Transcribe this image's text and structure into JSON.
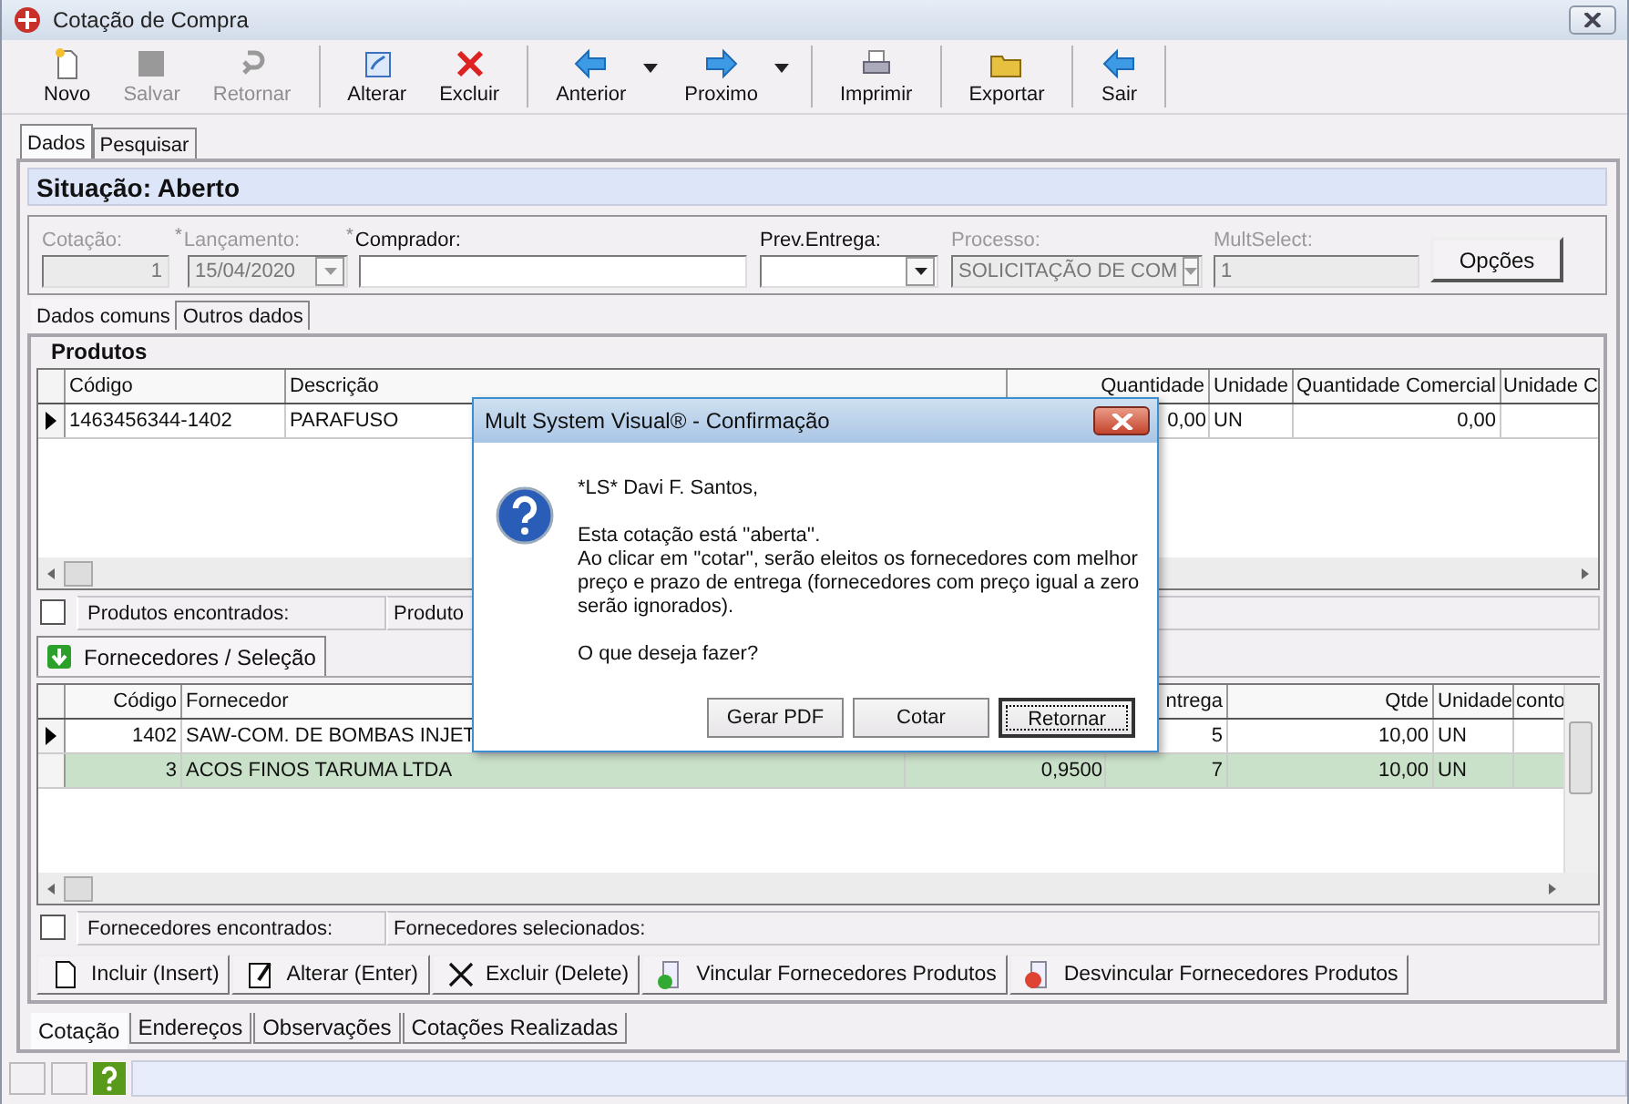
{
  "window": {
    "title": "Cotação de Compra"
  },
  "toolbar": [
    {
      "label": "Novo",
      "kind": "new",
      "disabled": false,
      "menu": false,
      "separator": false
    },
    {
      "label": "Salvar",
      "kind": "save",
      "disabled": true,
      "menu": false,
      "separator": false
    },
    {
      "label": "Retornar",
      "kind": "undo",
      "disabled": true,
      "menu": false,
      "separator": false
    },
    {
      "label": "Alterar",
      "kind": "edit",
      "disabled": false,
      "menu": false,
      "separator": true
    },
    {
      "label": "Excluir",
      "kind": "delete",
      "disabled": false,
      "menu": false,
      "separator": false
    },
    {
      "label": "Anterior",
      "kind": "prev",
      "disabled": false,
      "menu": true,
      "separator": true
    },
    {
      "label": "Proximo",
      "kind": "next",
      "disabled": false,
      "menu": true,
      "separator": false
    },
    {
      "label": "Imprimir",
      "kind": "print",
      "disabled": false,
      "menu": false,
      "separator": true
    },
    {
      "label": "Exportar",
      "kind": "export",
      "disabled": false,
      "menu": false,
      "separator": true
    },
    {
      "label": "Sair",
      "kind": "exit",
      "disabled": false,
      "menu": false,
      "separator": true
    }
  ],
  "tabs": [
    {
      "label": "Dados",
      "selected": true
    },
    {
      "label": "Pesquisar",
      "selected": false
    }
  ],
  "status": "Situação: Aberto",
  "fields": [
    {
      "label": "Cotação:",
      "kind": "number",
      "value": "1",
      "disabled": true
    },
    {
      "label": "Lançamento:",
      "kind": "date",
      "value": "15/04/2020",
      "disabled": true,
      "marker": "*"
    },
    {
      "label": "Comprador:",
      "kind": "text",
      "disabled": false,
      "marker": "*"
    },
    {
      "label": "Prev.Entrega:",
      "kind": "combo",
      "disabled": false
    },
    {
      "label": "Processo:",
      "kind": "combo",
      "value": "SOLICITAÇÃO DE COM",
      "disabled": true
    },
    {
      "label": "MultSelect:",
      "kind": "text",
      "value": "1",
      "disabled": true
    },
    {
      "label": "Opções",
      "kind": "button",
      "disabled": false
    }
  ],
  "inner_tabs": [
    {
      "label": "Dados comuns",
      "selected": true
    },
    {
      "label": "Outros dados",
      "selected": false
    }
  ],
  "products": {
    "title": "Produtos",
    "columns": [
      "Código",
      "Descrição",
      "Quantidade",
      "Unidade",
      "Quantidade Comercial",
      "Unidade C"
    ],
    "rows": [
      {
        "current": true,
        "selected": false,
        "cells": [
          "1463456344-1402",
          "PARAFUSO",
          "0,00",
          "UN",
          "0,00"
        ]
      }
    ],
    "footer": {
      "checked": false,
      "counts": [
        "Produtos encontrados:",
        "Produto"
      ]
    }
  },
  "suppliers": {
    "tab": "Fornecedores / Seleção",
    "columns": [
      "Código",
      "Fornecedor",
      null,
      "ntrega",
      "Qtde",
      "Unidade",
      "conto"
    ],
    "rows": [
      {
        "current": true,
        "selected": false,
        "cells": [
          "1402",
          "SAW-COM. DE BOMBAS INJET",
          null,
          "5",
          "10,00",
          "UN"
        ]
      },
      {
        "current": false,
        "selected": true,
        "cells": [
          "3",
          "ACOS FINOS TARUMA LTDA",
          "0,9500",
          "7",
          "10,00",
          "UN"
        ]
      }
    ],
    "footer": {
      "checked": false,
      "counts": [
        "Fornecedores encontrados:",
        "Fornecedores selecionados:"
      ]
    }
  },
  "actions": [
    {
      "label": "Incluir (Insert)",
      "kind": "new"
    },
    {
      "label": "Alterar (Enter)",
      "kind": "edit"
    },
    {
      "label": "Excluir (Delete)",
      "kind": "delete"
    },
    {
      "label": "Vincular Fornecedores Produtos",
      "kind": "link"
    },
    {
      "label": "Desvincular Fornecedores Produtos",
      "kind": "unlink"
    }
  ],
  "bottom_tabs": [
    {
      "label": "Cotação",
      "selected": true
    },
    {
      "label": "Endereços",
      "selected": false
    },
    {
      "label": "Observações",
      "selected": false
    },
    {
      "label": "Cotações Realizadas",
      "selected": false
    }
  ],
  "dialog": {
    "title": "Mult System Visual® - Confirmação",
    "greeting": "*LS* Davi F. Santos,",
    "message": "Esta cotação está ''aberta''.\nAo clicar em ''cotar'', serão eleitos os fornecedores com melhor\npreço e prazo de entrega (fornecedores com preço igual a zero\nserão ignorados).",
    "question": "O que deseja fazer?",
    "buttons": [
      {
        "label": "Gerar PDF",
        "focused": false
      },
      {
        "label": "Cotar",
        "focused": false
      },
      {
        "label": "Retornar",
        "focused": true
      }
    ]
  }
}
